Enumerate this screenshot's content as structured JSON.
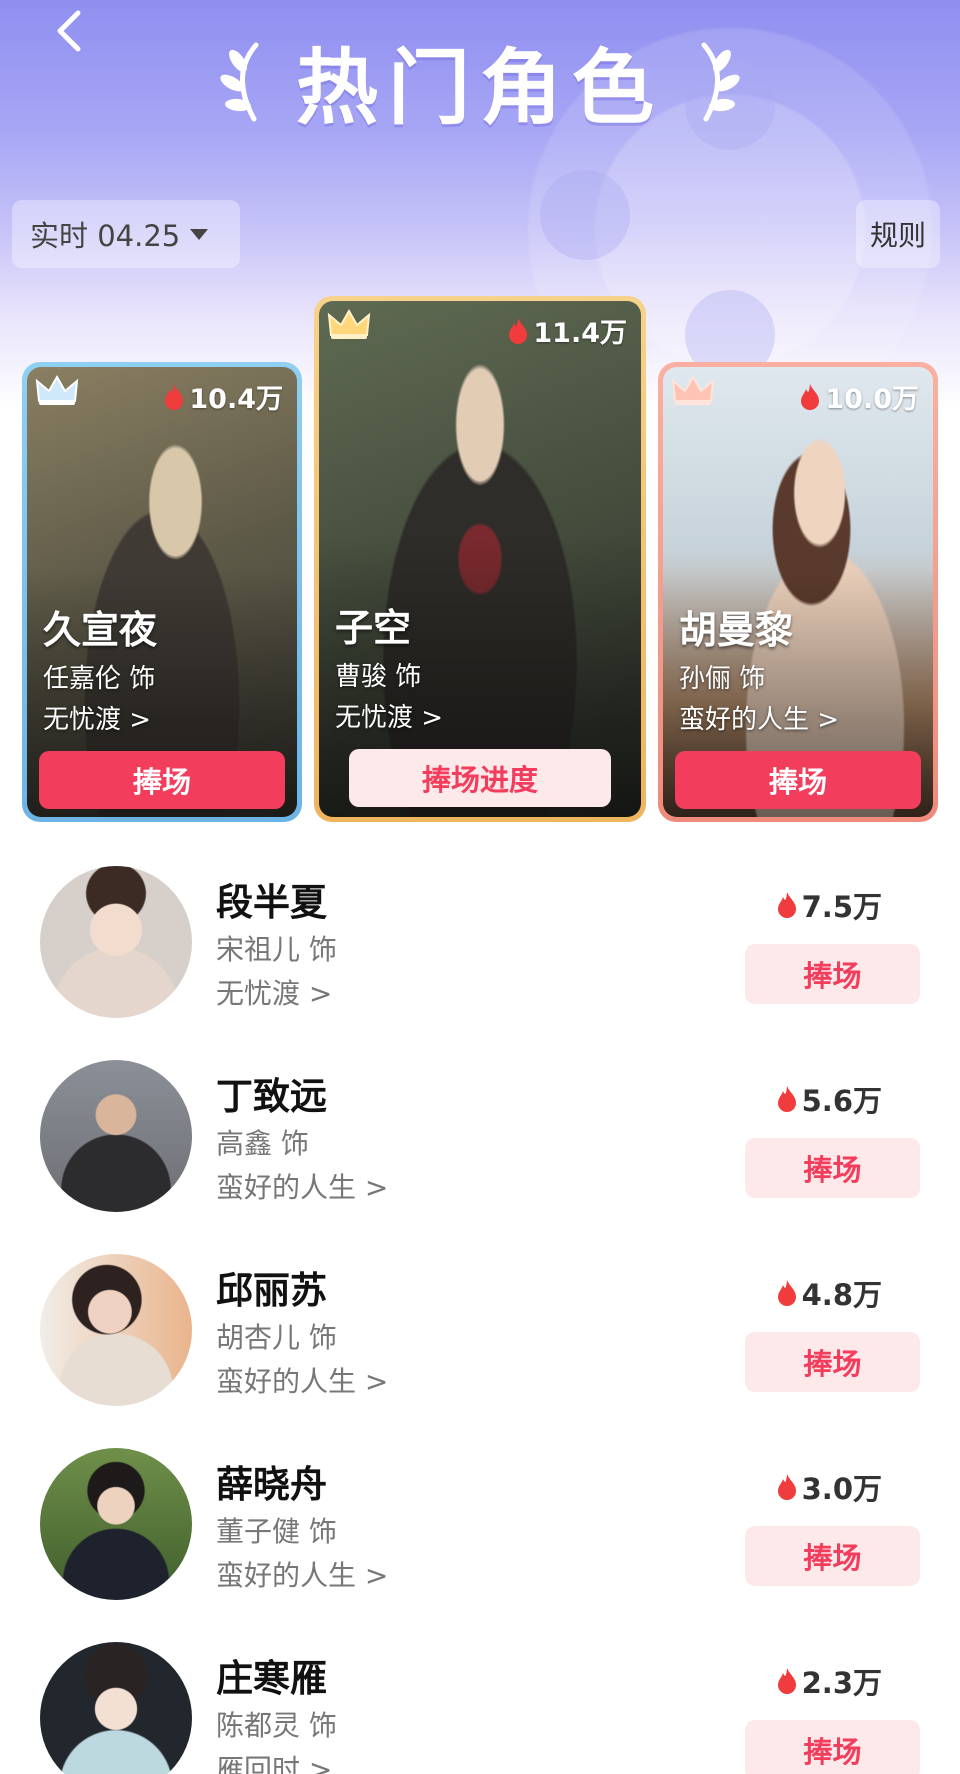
{
  "header": {
    "title": "热门角色",
    "back_icon": "chevron-left-icon",
    "date_label": "实时 04.25",
    "rules_label": "规则"
  },
  "colors": {
    "accent": "#f23d5c",
    "flame": "#f03c3c",
    "silver_frame": "#7cc6ee",
    "gold_frame": "#f2c06e",
    "bronze_frame": "#f3998c"
  },
  "podium": [
    {
      "rank": 1,
      "crown": "gold-crown-icon",
      "heat": "11.4万",
      "name": "子空",
      "actor": "曹骏 饰",
      "show": "无忧渡 >",
      "button": "捧场进度"
    },
    {
      "rank": 2,
      "crown": "silver-crown-icon",
      "heat": "10.4万",
      "name": "久宣夜",
      "actor": "任嘉伦 饰",
      "show": "无忧渡 >",
      "button": "捧场"
    },
    {
      "rank": 3,
      "crown": "bronze-crown-icon",
      "heat": "10.0万",
      "name": "胡曼黎",
      "actor": "孙俪 饰",
      "show": "蛮好的人生 >",
      "button": "捧场"
    }
  ],
  "list": [
    {
      "name": "段半夏",
      "actor": "宋祖儿 饰",
      "show": "无忧渡 >",
      "heat": "7.5万",
      "button": "捧场"
    },
    {
      "name": "丁致远",
      "actor": "高鑫 饰",
      "show": "蛮好的人生 >",
      "heat": "5.6万",
      "button": "捧场"
    },
    {
      "name": "邱丽苏",
      "actor": "胡杏儿 饰",
      "show": "蛮好的人生 >",
      "heat": "4.8万",
      "button": "捧场"
    },
    {
      "name": "薛晓舟",
      "actor": "董子健 饰",
      "show": "蛮好的人生 >",
      "heat": "3.0万",
      "button": "捧场"
    },
    {
      "name": "庄寒雁",
      "actor": "陈都灵 饰",
      "show": "雁回时 >",
      "heat": "2.3万",
      "button": "捧场"
    }
  ]
}
